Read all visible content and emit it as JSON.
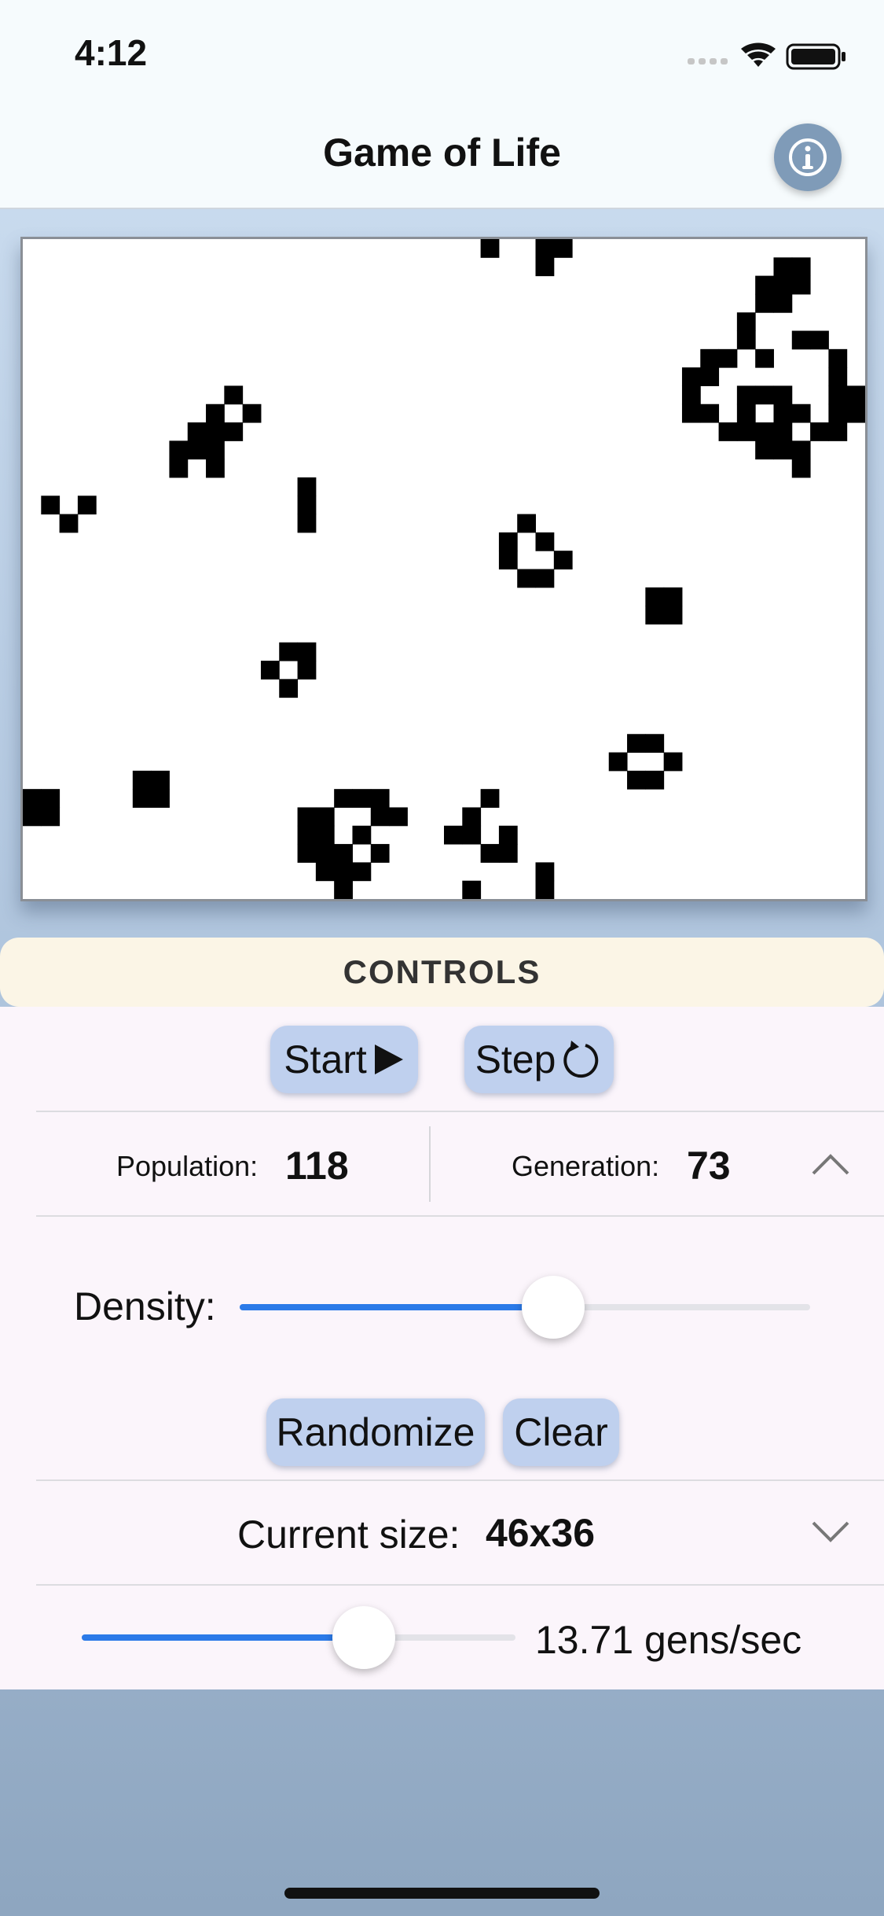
{
  "status_bar": {
    "time": "4:12"
  },
  "nav": {
    "title": "Game of Life",
    "info_icon": "info-icon"
  },
  "grid": {
    "columns": 46,
    "rows": 36,
    "live_cells": [
      [
        25,
        0
      ],
      [
        28,
        0
      ],
      [
        29,
        0
      ],
      [
        28,
        1
      ],
      [
        41,
        1
      ],
      [
        42,
        1
      ],
      [
        40,
        2
      ],
      [
        41,
        2
      ],
      [
        42,
        2
      ],
      [
        40,
        3
      ],
      [
        41,
        3
      ],
      [
        39,
        4
      ],
      [
        39,
        5
      ],
      [
        42,
        5
      ],
      [
        43,
        5
      ],
      [
        37,
        6
      ],
      [
        38,
        6
      ],
      [
        40,
        6
      ],
      [
        44,
        6
      ],
      [
        36,
        7
      ],
      [
        37,
        7
      ],
      [
        44,
        7
      ],
      [
        36,
        8
      ],
      [
        39,
        8
      ],
      [
        40,
        8
      ],
      [
        41,
        8
      ],
      [
        44,
        8
      ],
      [
        45,
        8
      ],
      [
        36,
        9
      ],
      [
        37,
        9
      ],
      [
        39,
        9
      ],
      [
        41,
        9
      ],
      [
        42,
        9
      ],
      [
        44,
        9
      ],
      [
        45,
        9
      ],
      [
        38,
        10
      ],
      [
        39,
        10
      ],
      [
        40,
        10
      ],
      [
        41,
        10
      ],
      [
        43,
        10
      ],
      [
        44,
        10
      ],
      [
        40,
        11
      ],
      [
        41,
        11
      ],
      [
        42,
        11
      ],
      [
        42,
        12
      ],
      [
        11,
        8
      ],
      [
        10,
        9
      ],
      [
        12,
        9
      ],
      [
        9,
        10
      ],
      [
        10,
        10
      ],
      [
        11,
        10
      ],
      [
        8,
        11
      ],
      [
        9,
        11
      ],
      [
        10,
        11
      ],
      [
        8,
        12
      ],
      [
        10,
        12
      ],
      [
        1,
        14
      ],
      [
        3,
        14
      ],
      [
        2,
        15
      ],
      [
        15,
        13
      ],
      [
        15,
        14
      ],
      [
        15,
        15
      ],
      [
        27,
        15
      ],
      [
        26,
        16
      ],
      [
        28,
        16
      ],
      [
        26,
        17
      ],
      [
        29,
        17
      ],
      [
        27,
        18
      ],
      [
        28,
        18
      ],
      [
        34,
        19
      ],
      [
        35,
        19
      ],
      [
        34,
        20
      ],
      [
        35,
        20
      ],
      [
        14,
        22
      ],
      [
        15,
        22
      ],
      [
        13,
        23
      ],
      [
        15,
        23
      ],
      [
        14,
        24
      ],
      [
        33,
        27
      ],
      [
        34,
        27
      ],
      [
        32,
        28
      ],
      [
        35,
        28
      ],
      [
        33,
        29
      ],
      [
        34,
        29
      ],
      [
        6,
        29
      ],
      [
        7,
        29
      ],
      [
        6,
        30
      ],
      [
        7,
        30
      ],
      [
        0,
        30
      ],
      [
        1,
        30
      ],
      [
        0,
        31
      ],
      [
        1,
        31
      ],
      [
        17,
        30
      ],
      [
        18,
        30
      ],
      [
        19,
        30
      ],
      [
        15,
        31
      ],
      [
        16,
        31
      ],
      [
        19,
        31
      ],
      [
        20,
        31
      ],
      [
        15,
        32
      ],
      [
        16,
        32
      ],
      [
        18,
        32
      ],
      [
        15,
        33
      ],
      [
        16,
        33
      ],
      [
        17,
        33
      ],
      [
        19,
        33
      ],
      [
        16,
        34
      ],
      [
        17,
        34
      ],
      [
        18,
        34
      ],
      [
        17,
        35
      ],
      [
        25,
        30
      ],
      [
        24,
        31
      ],
      [
        23,
        32
      ],
      [
        24,
        32
      ],
      [
        26,
        32
      ],
      [
        25,
        33
      ],
      [
        26,
        33
      ],
      [
        24,
        35
      ],
      [
        28,
        34
      ],
      [
        28,
        35
      ]
    ]
  },
  "controls": {
    "header": "CONTROLS",
    "start_label": "Start",
    "step_label": "Step",
    "population_label": "Population:",
    "population_value": "118",
    "generation_label": "Generation:",
    "generation_value": "73",
    "density_label": "Density:",
    "density_value": 0.55,
    "randomize_label": "Randomize",
    "clear_label": "Clear",
    "size_label": "Current size:",
    "size_value": "46x36",
    "speed_value": 0.65,
    "speed_label": "13.71 gens/sec"
  },
  "colors": {
    "accent": "#2b7ae8",
    "button_fill": "#bfd0ee",
    "header_fill": "#fbf5e6",
    "cell": "#000000"
  }
}
